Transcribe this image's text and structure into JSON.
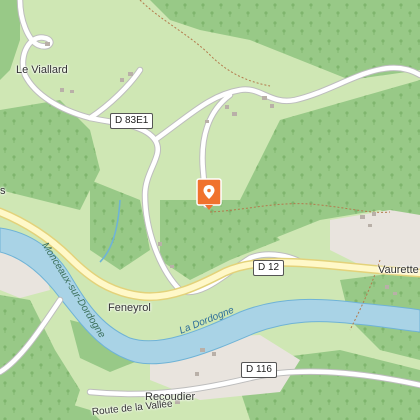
{
  "map": {
    "colors": {
      "forest": "#98c987",
      "meadow": "#cfe7b4",
      "water": "#a9d3e6",
      "river_line": "#6fb3d6",
      "road": "#ffffff",
      "major_road": "#fff8c8",
      "major_road_casing": "#e3d27a",
      "marker": "#f0722d",
      "settlement": "#e9e4de"
    },
    "places": {
      "le_viallard": "Le Viallard",
      "feneyrol": "Feneyrol",
      "vaurette": "Vaurette",
      "recoudier": "Recoudier",
      "partial_left": "s"
    },
    "roads": {
      "d83e1": "D 83E1",
      "d12": "D 12",
      "d116": "D 116",
      "route_vallee": "Route de la Vallée"
    },
    "water": {
      "dordogne": "La Dordogne",
      "monceaux": "Monceaux-sur-Dordogne"
    },
    "marker": {
      "icon": "location-pin-icon"
    }
  }
}
